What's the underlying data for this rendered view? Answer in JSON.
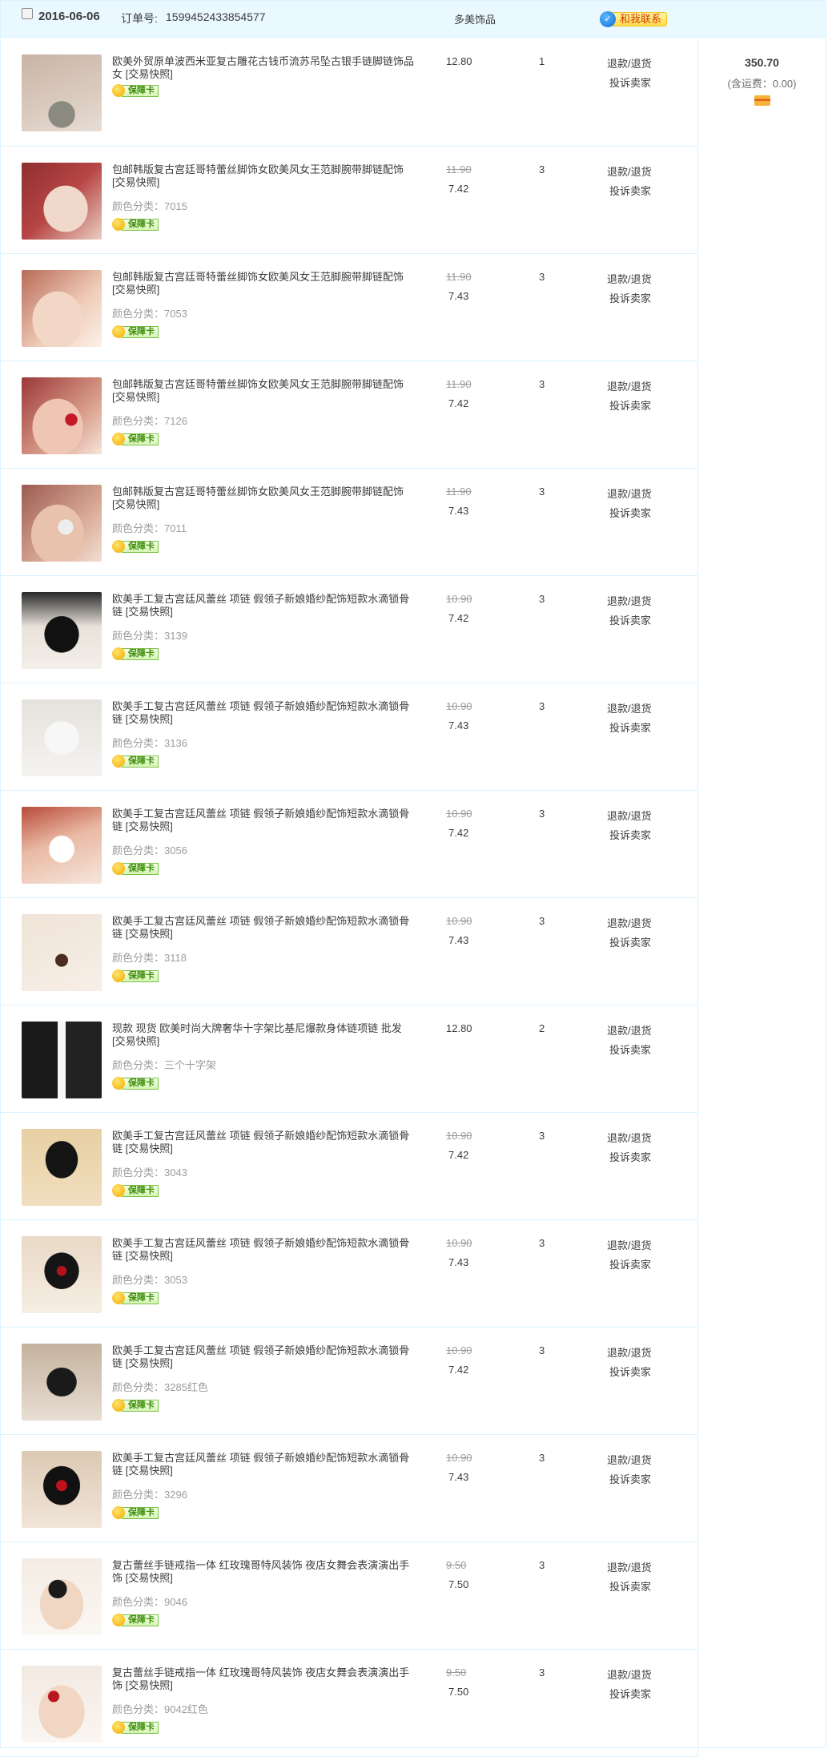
{
  "order": {
    "date": "2016-06-06",
    "order_no_label": "订单号:",
    "order_no": "1599452433854577",
    "shop": "多美饰品",
    "contact_label": "和我联系",
    "total": "350.70",
    "shipping": "(含运费：0.00)",
    "baozhang_label": "保障卡",
    "refund_label": "退款/退货",
    "complain_label": "投诉卖家"
  },
  "items": [
    {
      "title": "欧美外贸原单波西米亚复古雕花古钱币流苏吊坠古银手链脚链饰品女 [交易快照]",
      "sku": "",
      "price_old": "",
      "price": "12.80",
      "qty": "1"
    },
    {
      "title": "包邮韩版复古宫廷哥特蕾丝脚饰女欧美风女王范脚腕带脚链配饰 [交易快照]",
      "sku": "颜色分类：7015",
      "price_old": "11.90",
      "price": "7.42",
      "qty": "3"
    },
    {
      "title": "包邮韩版复古宫廷哥特蕾丝脚饰女欧美风女王范脚腕带脚链配饰 [交易快照]",
      "sku": "颜色分类：7053",
      "price_old": "11.90",
      "price": "7.43",
      "qty": "3"
    },
    {
      "title": "包邮韩版复古宫廷哥特蕾丝脚饰女欧美风女王范脚腕带脚链配饰 [交易快照]",
      "sku": "颜色分类：7126",
      "price_old": "11.90",
      "price": "7.42",
      "qty": "3"
    },
    {
      "title": "包邮韩版复古宫廷哥特蕾丝脚饰女欧美风女王范脚腕带脚链配饰 [交易快照]",
      "sku": "颜色分类：7011",
      "price_old": "11.90",
      "price": "7.43",
      "qty": "3"
    },
    {
      "title": "欧美手工复古宫廷风蕾丝 项链 假领子新娘婚纱配饰短款水滴锁骨链 [交易快照]",
      "sku": "颜色分类：3139",
      "price_old": "10.90",
      "price": "7.42",
      "qty": "3"
    },
    {
      "title": "欧美手工复古宫廷风蕾丝 项链 假领子新娘婚纱配饰短款水滴锁骨链 [交易快照]",
      "sku": "颜色分类：3136",
      "price_old": "10.90",
      "price": "7.43",
      "qty": "3"
    },
    {
      "title": "欧美手工复古宫廷风蕾丝 项链 假领子新娘婚纱配饰短款水滴锁骨链 [交易快照]",
      "sku": "颜色分类：3056",
      "price_old": "10.90",
      "price": "7.42",
      "qty": "3"
    },
    {
      "title": "欧美手工复古宫廷风蕾丝 项链 假领子新娘婚纱配饰短款水滴锁骨链 [交易快照]",
      "sku": "颜色分类：3118",
      "price_old": "10.90",
      "price": "7.43",
      "qty": "3"
    },
    {
      "title": "现款 现货 欧美时尚大牌奢华十字架比基尼爆款身体链项链 批发 [交易快照]",
      "sku": "颜色分类：三个十字架",
      "price_old": "",
      "price": "12.80",
      "qty": "2"
    },
    {
      "title": "欧美手工复古宫廷风蕾丝 项链 假领子新娘婚纱配饰短款水滴锁骨链 [交易快照]",
      "sku": "颜色分类：3043",
      "price_old": "10.90",
      "price": "7.42",
      "qty": "3"
    },
    {
      "title": "欧美手工复古宫廷风蕾丝 项链 假领子新娘婚纱配饰短款水滴锁骨链 [交易快照]",
      "sku": "颜色分类：3053",
      "price_old": "10.90",
      "price": "7.43",
      "qty": "3"
    },
    {
      "title": "欧美手工复古宫廷风蕾丝 项链 假领子新娘婚纱配饰短款水滴锁骨链 [交易快照]",
      "sku": "颜色分类：3285红色",
      "price_old": "10.90",
      "price": "7.42",
      "qty": "3"
    },
    {
      "title": "欧美手工复古宫廷风蕾丝 项链 假领子新娘婚纱配饰短款水滴锁骨链 [交易快照]",
      "sku": "颜色分类：3296",
      "price_old": "10.90",
      "price": "7.43",
      "qty": "3"
    },
    {
      "title": "复古蕾丝手链戒指一体 红玫瑰哥特风装饰 夜店女舞会表演演出手饰 [交易快照]",
      "sku": "颜色分类：9046",
      "price_old": "9.50",
      "price": "7.50",
      "qty": "3"
    },
    {
      "title": "复古蕾丝手链戒指一体 红玫瑰哥特风装饰 夜店女舞会表演演出手饰 [交易快照]",
      "sku": "颜色分类：9042红色",
      "price_old": "9.50",
      "price": "7.50",
      "qty": "3"
    }
  ],
  "thumb_styles": [
    "radial-gradient(circle at 50% 78%, #8a8a80 0 18%, transparent 19%), linear-gradient(160deg,#c9b4a6,#d9c9bd 55%,#e7ddd5)",
    "radial-gradient(ellipse at 55% 60%, #f0d9cb 0 35%, transparent 36%), linear-gradient(135deg,#8f2f2f,#b74545 50%,#e8cfc2)",
    "radial-gradient(ellipse at 45% 65%, #f3d7c6 0 40%, transparent 41%), linear-gradient(135deg,#b86b57,#f0cdb9 60%,#faf1ea)",
    "radial-gradient(circle at 62% 55%, #c41a28 0 9%, transparent 10%), radial-gradient(ellipse at 45% 65%, #efc6b4 0 40%, transparent 41%), linear-gradient(135deg,#9b3838,#d79a86 60%,#f6e4da)",
    "radial-gradient(circle at 55% 55%, #eeeeee 0 12%, transparent 13%), radial-gradient(ellipse at 45% 65%, #e9c2ad 0 42%, transparent 43%), linear-gradient(135deg,#9b5b52,#d8a894 60%,#f3ded2)",
    "radial-gradient(ellipse at 50% 55%, #111 0 30%, transparent 31%), linear-gradient(180deg,#2a2a2a,#e8e2da 45%,#f4efe9)",
    "radial-gradient(ellipse at 50% 50%, #f7f7f7 0 30%, transparent 31%), linear-gradient(180deg,#e6e2dd,#f5f3f0)",
    "radial-gradient(ellipse at 50% 55%, #ffffff 0 22%, transparent 23%), linear-gradient(160deg,#b84a3a,#e9b9a3 45%,#f6e6dc)",
    "radial-gradient(circle at 50% 60%, #4a2d1f 0 10%, transparent 11%), linear-gradient(160deg,#f0e4d8,#f7eee6)",
    "linear-gradient(90deg,#1a1a1a 0 45%, #f6f6f6 45% 55%, #222 55%)",
    "radial-gradient(ellipse at 50% 40%, #141414 0 28%, transparent 29%), linear-gradient(180deg,#e7cfa3,#f1dfbf)",
    "radial-gradient(circle at 50% 45%, #b3121c 0 8%, transparent 9%), radial-gradient(ellipse at 50% 45%, #151515 0 30%, transparent 31%), linear-gradient(180deg,#e9d9c6,#f6eee4)",
    "radial-gradient(ellipse at 50% 50%, #1a1a1a 0 26%, transparent 27%), linear-gradient(180deg,#c4b29e,#e8ded3)",
    "radial-gradient(circle at 50% 45%, #c0121d 0 9%, transparent 10%), radial-gradient(ellipse at 50% 45%, #111 0 32%, transparent 33%), linear-gradient(180deg,#dcc9b4,#f1e5d8)",
    "radial-gradient(circle at 45% 40%, #1a1a1a 0 14%, transparent 15%), radial-gradient(ellipse at 50% 60%, #f0d7c4 0 38%, transparent 39%), linear-gradient(180deg,#f4ece4,#fbf7f3)",
    "radial-gradient(circle at 40% 40%, #b8171f 0 8%, transparent 9%), radial-gradient(ellipse at 50% 60%, #f1d6c3 0 40%, transparent 41%), linear-gradient(180deg,#f2e9e1,#fbf6f2)"
  ]
}
